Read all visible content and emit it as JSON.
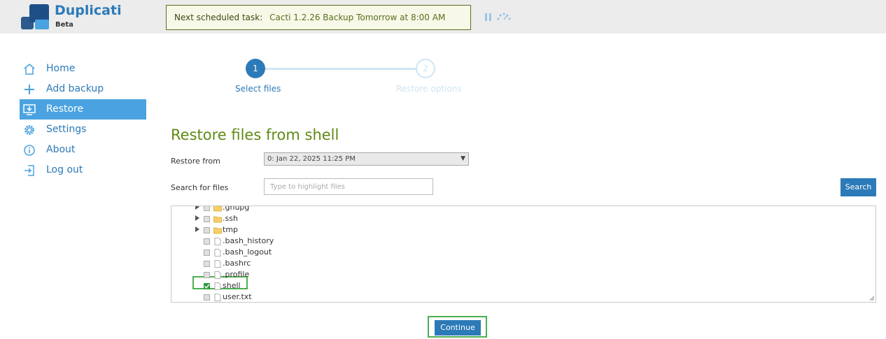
{
  "header": {
    "app_title": "Duplicati",
    "app_subtitle": "Beta",
    "scheduled_label": "Next scheduled task:",
    "scheduled_value": "Cacti 1.2.26 Backup Tomorrow at 8:00 AM"
  },
  "sidebar": {
    "items": [
      {
        "label": "Home",
        "icon": "home-icon"
      },
      {
        "label": "Add backup",
        "icon": "plus-icon"
      },
      {
        "label": "Restore",
        "icon": "restore-icon",
        "active": true
      },
      {
        "label": "Settings",
        "icon": "gear-icon"
      },
      {
        "label": "About",
        "icon": "info-icon"
      },
      {
        "label": "Log out",
        "icon": "logout-icon"
      }
    ]
  },
  "stepper": {
    "steps": [
      {
        "number": "1",
        "label": "Select files"
      },
      {
        "number": "2",
        "label": "Restore options"
      }
    ]
  },
  "main": {
    "title": "Restore files from shell",
    "restore_from_label": "Restore from",
    "restore_from_value": "0: Jan 22, 2025 11:25 PM",
    "search_label": "Search for files",
    "search_placeholder": "Type to highlight files",
    "search_button": "Search",
    "continue_button": "Continue"
  },
  "tree": {
    "rows": [
      {
        "name": ".gnupg",
        "type": "folder",
        "expandable": true,
        "checked": false
      },
      {
        "name": ".ssh",
        "type": "folder",
        "expandable": true,
        "checked": false
      },
      {
        "name": "tmp",
        "type": "folder",
        "expandable": true,
        "checked": false
      },
      {
        "name": ".bash_history",
        "type": "file",
        "expandable": false,
        "checked": false
      },
      {
        "name": ".bash_logout",
        "type": "file",
        "expandable": false,
        "checked": false
      },
      {
        "name": ".bashrc",
        "type": "file",
        "expandable": false,
        "checked": false
      },
      {
        "name": ".profile",
        "type": "file",
        "expandable": false,
        "checked": false
      },
      {
        "name": "shell",
        "type": "file",
        "expandable": false,
        "checked": true
      },
      {
        "name": "user.txt",
        "type": "file",
        "expandable": false,
        "checked": false
      }
    ]
  },
  "colors": {
    "accent": "#2c7ab8",
    "active_nav": "#4aa3e0",
    "title_green": "#5f8a14",
    "highlight_green": "#4caf50"
  }
}
